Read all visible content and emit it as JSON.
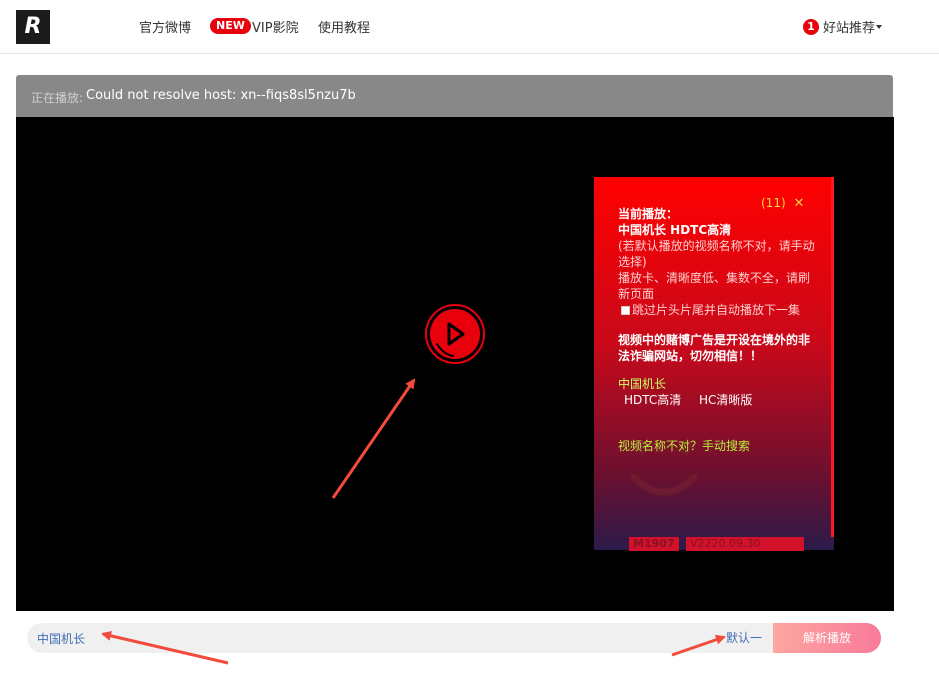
{
  "header": {
    "logo": "R",
    "nav": {
      "weibo": "官方微博",
      "new_badge": "NEW",
      "vip": "VIP影院",
      "tutorial": "使用教程"
    },
    "recommend_count": "1",
    "recommend_label": "好站推荐"
  },
  "status": {
    "label": "正在播放:",
    "value": "Could not resolve host: xn--fiqs8sl5nzu7b"
  },
  "popup": {
    "countdown": "(11)",
    "close": "✕",
    "current_label": "当前播放：",
    "current_title": "中国机长 HDTC高清",
    "hint1": "(若默认播放的视频名称不对，请手动",
    "hint2": "选择)",
    "hint3": "播放卡、清晰度低、集数不全，请刷",
    "hint4": "新页面",
    "skip_label": "跳过片头片尾并自动播放下一集",
    "warn1": "视频中的赌博广告是开设在境外的非",
    "warn2": "法诈骗网站，切勿相信！！",
    "movie_name": "中国机长",
    "sources": [
      "HDTC高清",
      "HC清晰版"
    ],
    "manual_search": "视频名称不对？手动搜索",
    "version_left": "M1907",
    "version_right": "V2220.09.30"
  },
  "bottom": {
    "input_value": "中国机长",
    "default_label": "默认一",
    "parse_button": "解析播放"
  },
  "colors": {
    "accent_red": "#e8000d",
    "link_blue": "#3f6eb5",
    "status_gray": "#888888"
  }
}
